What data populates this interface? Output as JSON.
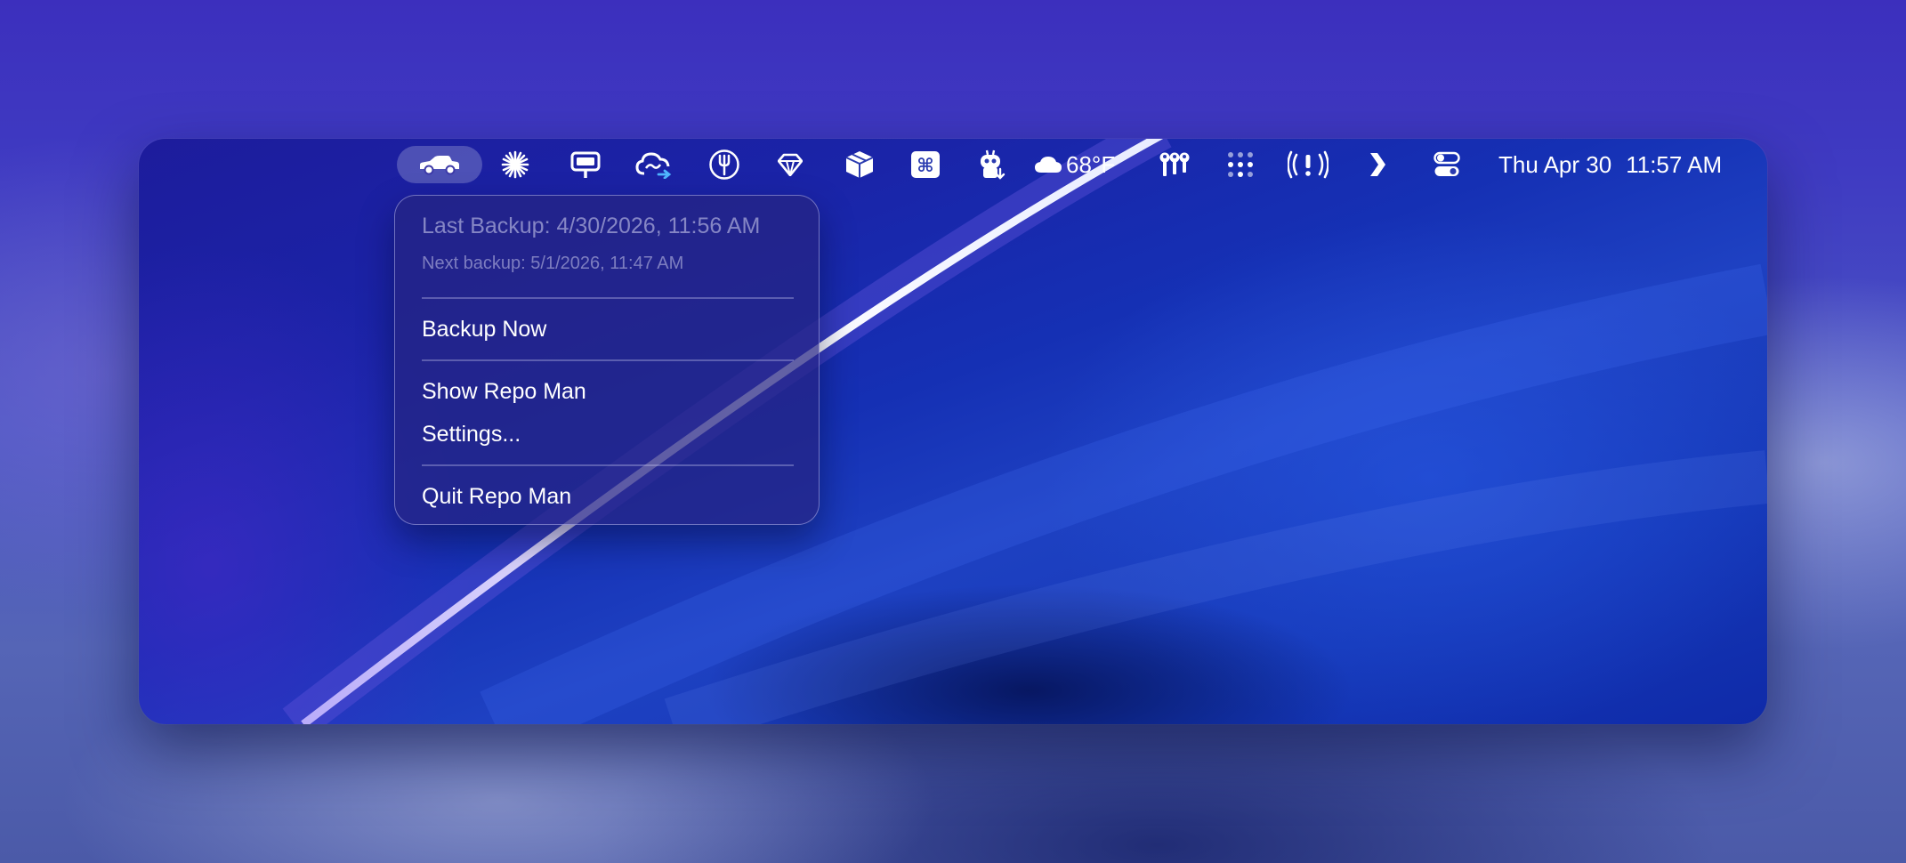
{
  "menubar": {
    "active_app_icon": "car-icon",
    "status_icons": [
      "sparkle-burst-icon",
      "sign-board-icon",
      "cloud-sync-icon",
      "fork-icon",
      "gem-icon",
      "box-icon",
      "command-key-icon",
      "robot-download-icon",
      "cloud-icon",
      "keys-icon",
      "dot-grid-icon",
      "alert-broadcast-icon",
      "chevron-right-icon",
      "control-center-icon"
    ],
    "weather": "68°F",
    "date": "Thu Apr 30",
    "time": "11:57 AM"
  },
  "menu": {
    "last_backup": "Last Backup: 4/30/2026, 11:56 AM",
    "next_backup": "Next backup: 5/1/2026, 11:47 AM",
    "backup_now": "Backup Now",
    "show_app": "Show Repo Man",
    "settings": "Settings...",
    "quit": "Quit Repo Man"
  },
  "colors": {
    "menu_background": "#26248a",
    "menu_text": "#ffffff",
    "menu_disabled_text": "#a8a8d8",
    "wallpaper_accent": "#1530b4"
  }
}
